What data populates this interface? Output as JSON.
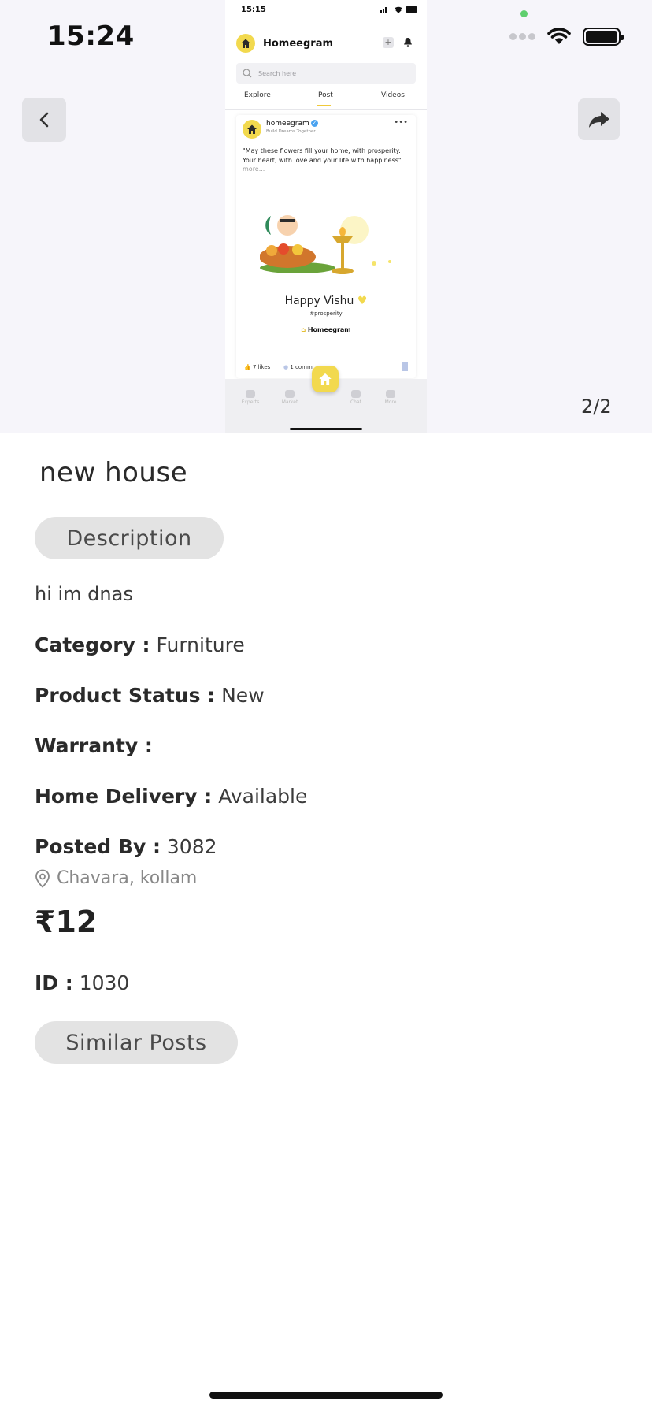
{
  "status_bar": {
    "time": "15:24"
  },
  "gallery": {
    "page_counter": "2/2",
    "phone": {
      "status_time": "15:15",
      "brand": "Homeegram",
      "search_placeholder": "Search here",
      "tabs": [
        "Explore",
        "Post",
        "Videos"
      ],
      "active_tab": "Post",
      "post": {
        "account": "homeegram",
        "tagline": "Build Dreams Together",
        "caption": "\"May these flowers fill your home, with prosperity. Your heart, with love and your life with happiness\"",
        "more": "more...",
        "headline": "Happy Vishu",
        "hashtag": "#prosperity",
        "wordmark": "Homeegram",
        "likes": "7 likes",
        "comments": "1 comm"
      },
      "bottom_nav": [
        "Experts",
        "Market",
        "Chat",
        "More"
      ]
    }
  },
  "product": {
    "title": "new house",
    "description_button": "Description",
    "description": "hi im dnas",
    "category_label": "Category :",
    "category": "Furniture",
    "status_label": "Product Status :",
    "status": "New",
    "warranty_label": "Warranty :",
    "warranty": "",
    "delivery_label": "Home Delivery :",
    "delivery": "Available",
    "posted_by_label": "Posted By :",
    "posted_by": "3082",
    "location": "Chavara, kollam",
    "price": "₹12",
    "id_label": "ID :",
    "id": "1030",
    "similar_button": "Similar Posts"
  },
  "colors": {
    "accent_yellow": "#f2d94e",
    "pill_bg": "#e3e3e3",
    "gallery_bg": "#f6f5fa"
  }
}
